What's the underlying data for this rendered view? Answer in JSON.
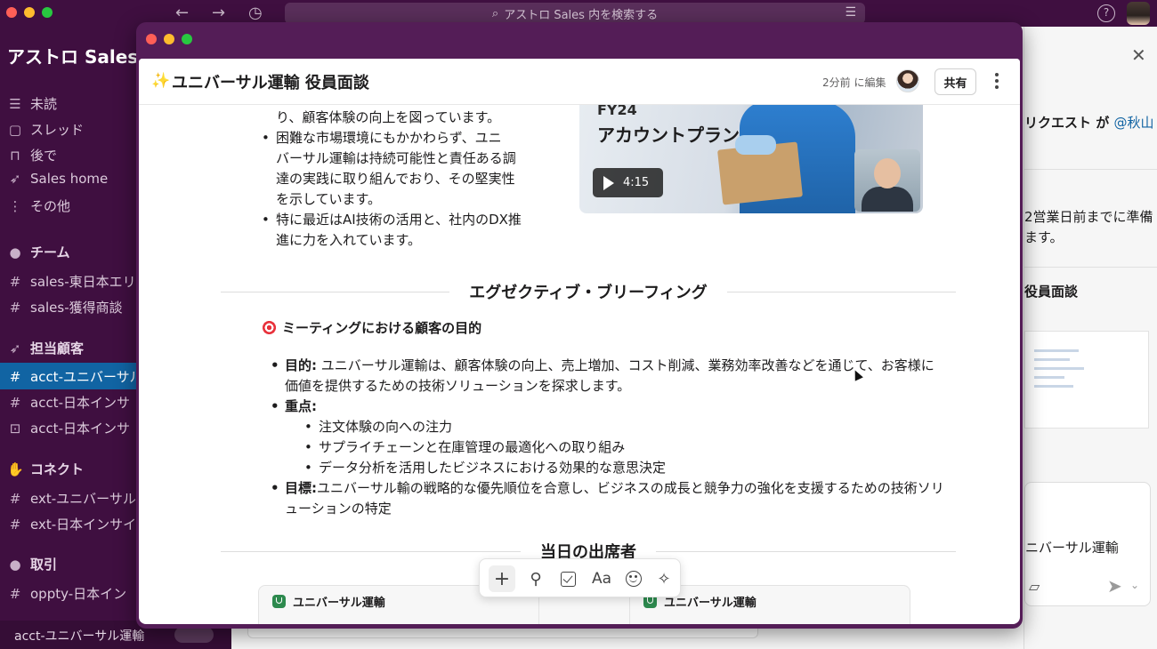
{
  "app": {
    "search_placeholder": "アストロ Sales 内を検索する",
    "workspace": "アストロ Sales"
  },
  "sidebar": {
    "nav": [
      {
        "icon": "inbox-icon",
        "label": "未読"
      },
      {
        "icon": "threads-icon",
        "label": "スレッド"
      },
      {
        "icon": "bookmark-icon",
        "label": "後で"
      },
      {
        "icon": "rocket-icon",
        "label": "Sales home"
      },
      {
        "icon": "more-vertical-icon",
        "label": "その他"
      }
    ],
    "sections": [
      {
        "title": "チーム",
        "channels": [
          "sales-東日本エリ",
          "sales-獲得商談"
        ]
      },
      {
        "title": "担当顧客",
        "channels": [
          "acct-ユニバーサル",
          "acct-日本インサ",
          "acct-日本インサ"
        ]
      },
      {
        "title": "コネクト",
        "channels": [
          "ext-ユニバーサル",
          "ext-日本インサイ"
        ]
      },
      {
        "title": "取引",
        "channels": [
          "oppty-日本イン"
        ]
      }
    ],
    "bottom_label": "acct-ユニバーサル運輸"
  },
  "right_panel": {
    "request_text": "リクエスト が",
    "mention": "@秋山",
    "deadline_line1": "2営業日前までに準備",
    "deadline_line2": "ます。",
    "canvas_ref": "役員面談",
    "compose_text": "ニバーサル運輸"
  },
  "canvas": {
    "title": "ユニバーサル運輸 役員面談",
    "edited": "2分前 に編集",
    "share_label": "共有",
    "intro_bullets": [
      "ションとデジタル技術への投資によ\nり、顧客体験の向上を図っています。",
      "困難な市場環境にもかかわらず、ユニ\nバーサル運輸は持続可能性と責任ある調\n達の実践に取り組んでおり、その堅実性\nを示しています。",
      "特に最近はAI技術の活用と、社内のDX推\n進に力を入れています。"
    ],
    "video": {
      "fy": "FY24",
      "title": "アカウントプラン",
      "duration": "4:15"
    },
    "section_briefing": "エグゼクティブ・ブリーフィング",
    "goal_heading": "ミーティングにおける顧客の目的",
    "goal_items": {
      "purpose_label": "目的:",
      "purpose_text": " ユニバーサル運輸は、顧客体験の向上、売上増加、コスト削減、業務効率改善などを通じて、お客様に価値を提供するための技術ソリューションを探求します。",
      "focus_label": "重点:",
      "focus_points": [
        "注文体験の向への注力",
        "サプライチェーンと在庫管理の最適化への取り組み",
        "データ分析を活用したビジネスにおける効果的な意思決定"
      ],
      "target_label": "目標:",
      "target_text": "ユニバーサル輸の戦略的な優先順位を合意し、ビジネスの成長と競争力の強化を支援するための技術ソリューションの特定"
    },
    "section_attendees": "当日の出席者",
    "attendee_columns": [
      "ユニバーサル運輸",
      "ユニバーサル運輸"
    ],
    "toolbar": {
      "font_label": "Aa"
    }
  }
}
